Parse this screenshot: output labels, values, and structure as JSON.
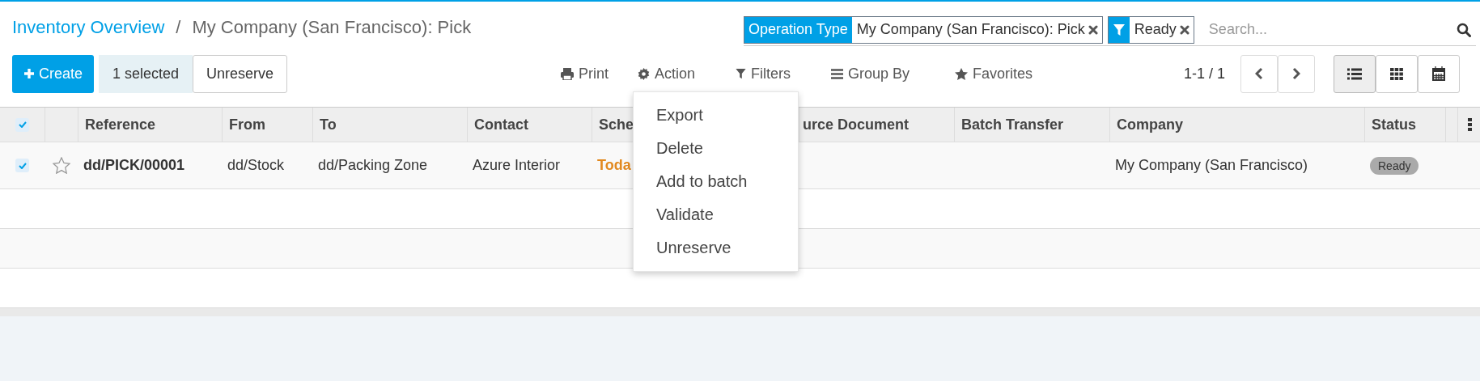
{
  "breadcrumb": {
    "link": "Inventory Overview",
    "separator": "/",
    "current": "My Company (San Francisco): Pick"
  },
  "search": {
    "facets": [
      {
        "kind": "field",
        "label": "Operation Type",
        "value": "My Company (San Francisco): Pick"
      },
      {
        "kind": "filter",
        "value": "Ready"
      }
    ],
    "placeholder": "Search..."
  },
  "buttons": {
    "create": "Create",
    "selected_count": "1 selected",
    "unreserve": "Unreserve"
  },
  "toolbar": [
    {
      "kind": "print",
      "label": "Print"
    },
    {
      "kind": "action",
      "label": "Action"
    },
    {
      "kind": "filter",
      "label": "Filters"
    },
    {
      "kind": "group",
      "label": "Group By"
    },
    {
      "kind": "favorite",
      "label": "Favorites"
    }
  ],
  "pager": "1-1 / 1",
  "views": [
    {
      "kind": "list",
      "selected": true
    },
    {
      "kind": "kanban",
      "selected": false
    },
    {
      "kind": "calendar",
      "selected": false
    }
  ],
  "table": {
    "all_checked": true,
    "columns": [
      "Reference",
      "From",
      "To",
      "Contact",
      "Sche",
      "urce Document",
      "Batch Transfer",
      "Company",
      "Status"
    ],
    "rows": [
      {
        "checked": true,
        "starred": false,
        "cells": [
          "dd/PICK/00001",
          "dd/Stock",
          "dd/Packing Zone",
          "Azure Interior",
          "Toda",
          "",
          "",
          "My Company (San Francisco)"
        ],
        "status": "Ready"
      }
    ]
  },
  "action_menu": [
    "Export",
    "Delete",
    "Add to batch",
    "Validate",
    "Unreserve"
  ]
}
